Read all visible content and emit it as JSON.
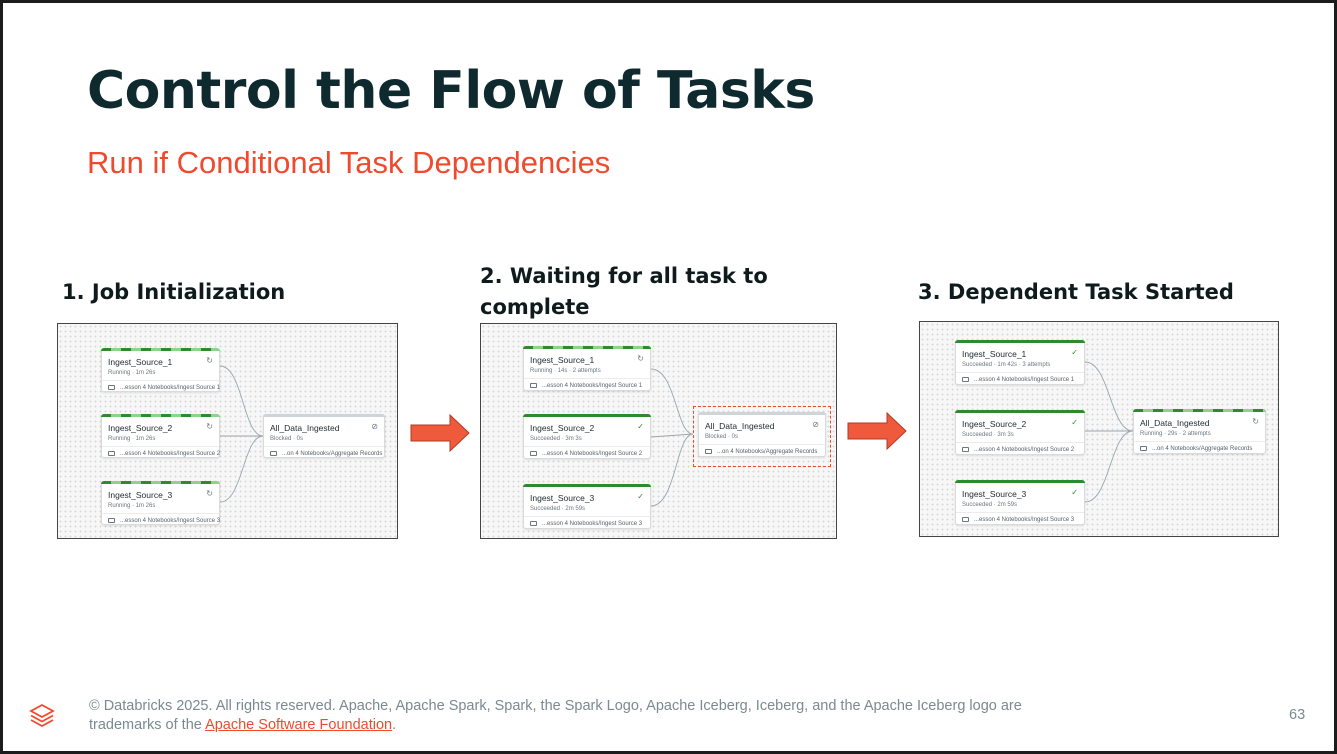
{
  "slide": {
    "title": "Control the Flow of Tasks",
    "subtitle": "Run if Conditional Task Dependencies",
    "footer_text": "© Databricks 2025. All rights reserved. Apache, Apache Spark, Spark, the Spark Logo, Apache Iceberg, Iceberg, and the Apache Iceberg logo are trademarks of the ",
    "footer_link": "Apache Software Foundation",
    "footer_end": ".",
    "page_number": "63",
    "brand_color": "#f04a2e"
  },
  "steps": [
    {
      "label": "1.  Job Initialization",
      "tasks": [
        {
          "name": "Ingest_Source_1",
          "status": "Running  ·  1m 26s",
          "path": "...esson 4 Notebooks/Ingest Source 1",
          "state": "running",
          "icon": "refresh-icon"
        },
        {
          "name": "Ingest_Source_2",
          "status": "Running  ·  1m 26s",
          "path": "...esson 4 Notebooks/Ingest Source 2",
          "state": "running",
          "icon": "refresh-icon"
        },
        {
          "name": "Ingest_Source_3",
          "status": "Running  ·  1m 26s",
          "path": "...esson 4 Notebooks/Ingest Source 3",
          "state": "running",
          "icon": "refresh-icon"
        }
      ],
      "target": {
        "name": "All_Data_Ingested",
        "status": "Blocked  ·  0s",
        "path": "...on 4 Notebooks/Aggregate Records",
        "state": "blocked",
        "icon": "blocked-icon"
      }
    },
    {
      "label_line1": "2. Waiting for all task to",
      "label_line2": "complete",
      "tasks": [
        {
          "name": "Ingest_Source_1",
          "status": "Running  ·  14s  ·  2 attempts",
          "path": "...esson 4 Notebooks/Ingest Source 1",
          "state": "running",
          "icon": "refresh-icon"
        },
        {
          "name": "Ingest_Source_2",
          "status": "Succeeded  ·  3m 3s",
          "path": "...esson 4 Notebooks/Ingest Source 2",
          "state": "succeeded",
          "icon": "check-circle-icon"
        },
        {
          "name": "Ingest_Source_3",
          "status": "Succeeded  ·  2m 59s",
          "path": "...esson 4 Notebooks/Ingest Source 3",
          "state": "succeeded",
          "icon": "check-circle-icon"
        }
      ],
      "target": {
        "name": "All_Data_Ingested",
        "status": "Blocked  ·  0s",
        "path": "...on 4 Notebooks/Aggregate Records",
        "state": "blocked",
        "icon": "blocked-icon"
      }
    },
    {
      "label": "3. Dependent Task Started",
      "tasks": [
        {
          "name": "Ingest_Source_1",
          "status": "Succeeded  ·  1m 42s  ·  3 attempts",
          "path": "...esson 4 Notebooks/Ingest Source 1",
          "state": "succeeded",
          "icon": "check-circle-icon"
        },
        {
          "name": "Ingest_Source_2",
          "status": "Succeeded  ·  3m 3s",
          "path": "...esson 4 Notebooks/Ingest Source 2",
          "state": "succeeded",
          "icon": "check-circle-icon"
        },
        {
          "name": "Ingest_Source_3",
          "status": "Succeeded  ·  2m 59s",
          "path": "...esson 4 Notebooks/Ingest Source 3",
          "state": "succeeded",
          "icon": "check-circle-icon"
        }
      ],
      "target": {
        "name": "All_Data_Ingested",
        "status": "Running  ·  29s  ·  2 attempts",
        "path": "...on 4 Notebooks/Aggregate Records",
        "state": "running",
        "icon": "refresh-icon"
      }
    }
  ]
}
